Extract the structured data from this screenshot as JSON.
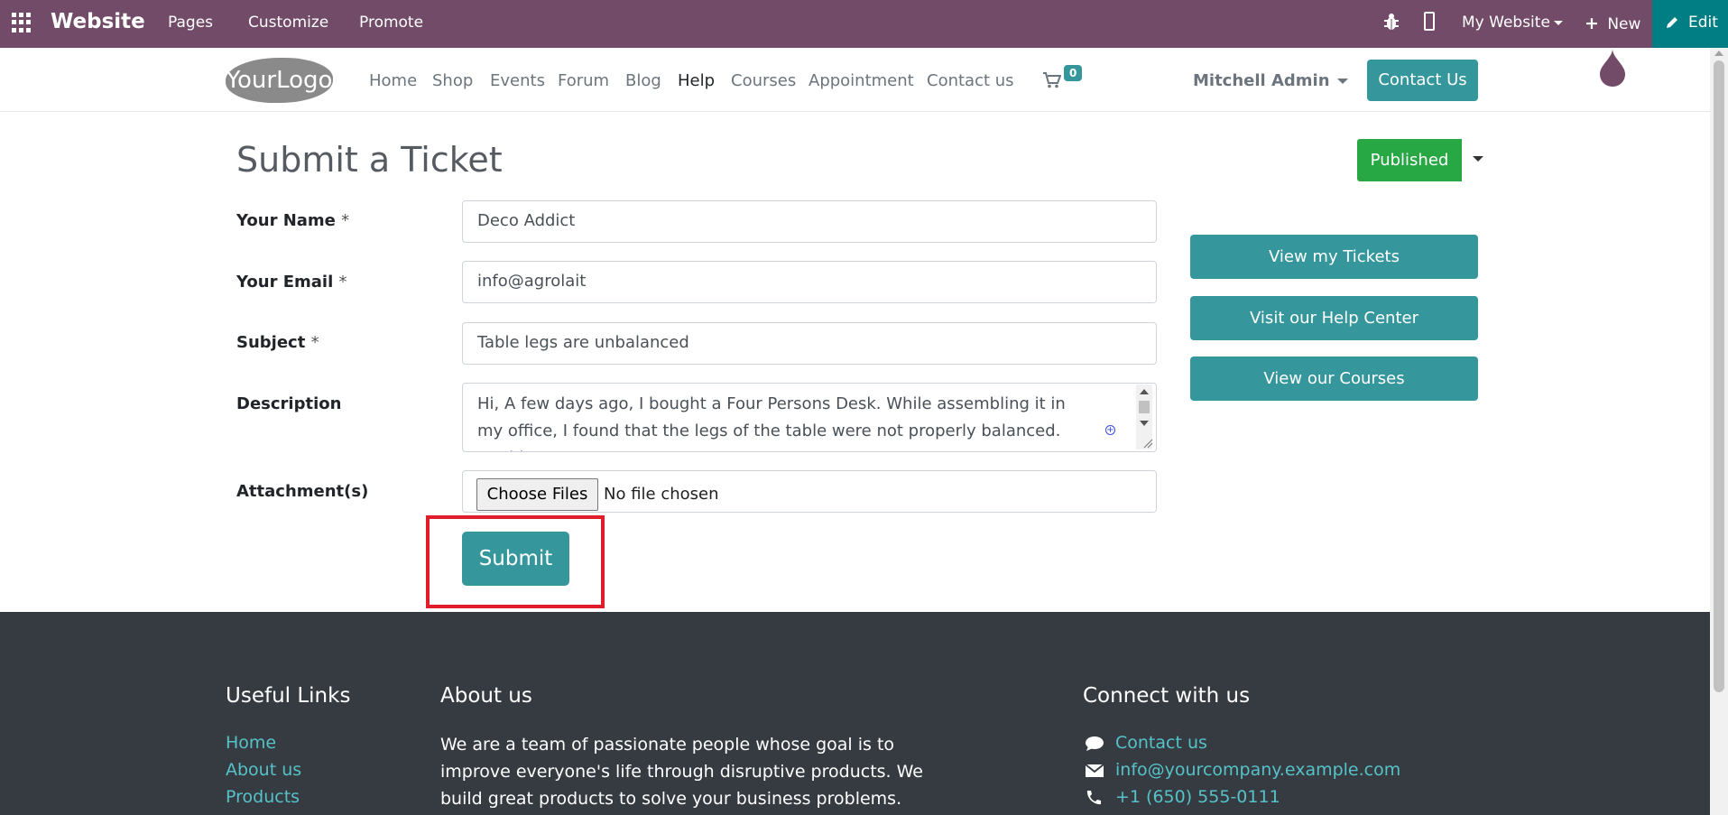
{
  "topbar": {
    "app_name": "Website",
    "menu": [
      "Pages",
      "Customize",
      "Promote"
    ],
    "site_selector": "My Website",
    "new_label": "New",
    "edit_label": "Edit"
  },
  "navbar": {
    "logo": "YourLogo",
    "links": [
      "Home",
      "Shop",
      "Events",
      "Forum",
      "Blog",
      "Help",
      "Courses",
      "Appointment",
      "Contact us"
    ],
    "active_link": "Help",
    "cart_count": "0",
    "user": "Mitchell Admin",
    "contact_button": "Contact Us"
  },
  "page": {
    "title": "Submit a Ticket",
    "status": "Published"
  },
  "form": {
    "name_label": "Your Name",
    "name_value": "Deco Addict",
    "email_label": "Your Email",
    "email_value": "info@agrolait",
    "subject_label": "Subject",
    "subject_value": "Table legs are unbalanced",
    "description_label": "Description",
    "description_value": "Hi, A few days ago, I bought a Four Persons Desk. While assembling it in my office, I found that the legs of the table were not properly balanced. Could you",
    "attachment_label": "Attachment(s)",
    "choose_files": "Choose Files",
    "no_file": "No file chosen",
    "required_marker": "*",
    "submit": "Submit"
  },
  "sidebar": {
    "buttons": [
      "View my Tickets",
      "Visit our Help Center",
      "View our Courses"
    ]
  },
  "footer": {
    "useful_links_title": "Useful Links",
    "useful_links": [
      "Home",
      "About us",
      "Products"
    ],
    "about_title": "About us",
    "about_text": "We are a team of passionate people whose goal is to improve everyone's life through disruptive products. We build great products to solve your business problems.",
    "connect_title": "Connect with us",
    "contact_link": "Contact us",
    "email": "info@yourcompany.example.com",
    "phone": "+1 (650) 555-0111"
  },
  "colors": {
    "topbar": "#714b67",
    "accent": "#35979c",
    "published": "#28a745",
    "footer_bg": "#363b42",
    "footer_link": "#55c2c8",
    "highlight": "#e01e2b"
  }
}
